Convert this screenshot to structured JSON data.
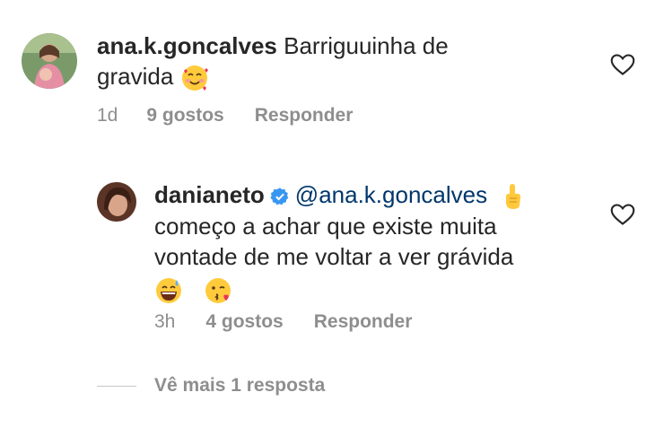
{
  "comments": [
    {
      "username": "ana.k.goncalves",
      "text_line1": "Barriguuinha de",
      "text_line2": "gravida",
      "time": "1d",
      "likes": "9 gostos",
      "reply_label": "Responder",
      "emoji": "smiling-face-with-hearts"
    },
    {
      "username": "danianeto",
      "verified": true,
      "mention": "@ana.k.goncalves",
      "text_line1": "começo a achar que existe muita",
      "text_line2": "vontade de me voltar a ver grávida",
      "time": "3h",
      "likes": "4 gostos",
      "reply_label": "Responder",
      "emojis": [
        "index-pointing-up",
        "grinning-face-with-sweat",
        "face-blowing-kiss"
      ]
    }
  ],
  "view_more": "Vê mais 1 resposta",
  "colors": {
    "text": "#262626",
    "muted": "#8e8e8e",
    "mention": "#00376b",
    "verified": "#3897f0"
  }
}
